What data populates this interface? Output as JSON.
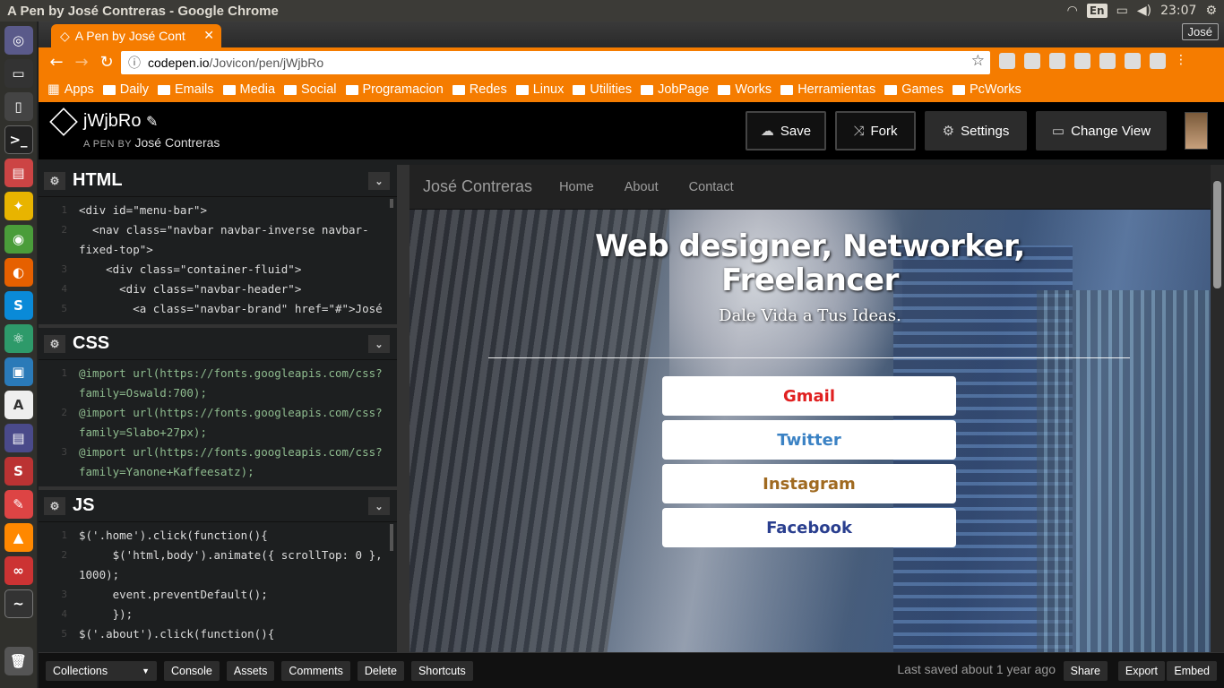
{
  "os": {
    "window_title": "A Pen by José Contreras - Google Chrome",
    "keyboard_layout": "En",
    "clock": "23:07"
  },
  "browser": {
    "tab_title": "A Pen by José Cont",
    "user": "José",
    "url_host": "codepen.io",
    "url_path": "/Jovicon/pen/jWjbRo",
    "bookmarks": [
      "Apps",
      "Daily",
      "Emails",
      "Media",
      "Social",
      "Programacion",
      "Redes",
      "Linux",
      "Utilities",
      "JobPage",
      "Works",
      "Herramientas",
      "Games",
      "PcWorks"
    ]
  },
  "codepen": {
    "pen_title": "jWjbRo",
    "pen_by_label": "A PEN BY",
    "author": "José Contreras",
    "buttons": {
      "save": "Save",
      "fork": "Fork",
      "settings": "Settings",
      "change_view": "Change View"
    },
    "html_editor": {
      "title": "HTML",
      "lines": [
        {
          "n": "1",
          "t": "<div id=\"menu-bar\">"
        },
        {
          "n": "2",
          "t": "  <nav class=\"navbar navbar-inverse navbar-"
        },
        {
          "n": "",
          "t": "fixed-top\">"
        },
        {
          "n": "3",
          "t": "    <div class=\"container-fluid\">"
        },
        {
          "n": "4",
          "t": "      <div class=\"navbar-header\">"
        },
        {
          "n": "5",
          "t": "        <a class=\"navbar-brand\" href=\"#\">José"
        }
      ]
    },
    "css_editor": {
      "title": "CSS",
      "lines": [
        {
          "n": "1",
          "t": "@import url(https://fonts.googleapis.com/css?"
        },
        {
          "n": "",
          "t": "family=Oswald:700);"
        },
        {
          "n": "2",
          "t": "@import url(https://fonts.googleapis.com/css?"
        },
        {
          "n": "",
          "t": "family=Slabo+27px);"
        },
        {
          "n": "3",
          "t": "@import url(https://fonts.googleapis.com/css?"
        },
        {
          "n": "",
          "t": "family=Yanone+Kaffeesatz);"
        }
      ]
    },
    "js_editor": {
      "title": "JS",
      "lines": [
        {
          "n": "1",
          "t": "$('.home').click(function(){"
        },
        {
          "n": "2",
          "t": "     $('html,body').animate({ scrollTop: 0 },"
        },
        {
          "n": "",
          "t": "1000);"
        },
        {
          "n": "3",
          "t": "     event.preventDefault();"
        },
        {
          "n": "4",
          "t": "     });"
        },
        {
          "n": "5",
          "t": "$('.about').click(function(){"
        }
      ]
    },
    "footer": {
      "collections": "Collections",
      "console": "Console",
      "assets": "Assets",
      "comments": "Comments",
      "delete": "Delete",
      "shortcuts": "Shortcuts",
      "last_saved": "Last saved about 1 year ago",
      "share": "Share",
      "export": "Export",
      "embed": "Embed"
    }
  },
  "preview": {
    "brand": "José Contreras",
    "nav": [
      "Home",
      "About",
      "Contact"
    ],
    "headline_line1": "Web designer, Networker,",
    "headline_line2": "Freelancer",
    "tagline": "Dale Vida a Tus Ideas.",
    "social_buttons": [
      {
        "label": "Gmail",
        "color": "#e02020"
      },
      {
        "label": "Twitter",
        "color": "#3b82c4"
      },
      {
        "label": "Instagram",
        "color": "#a06a20"
      },
      {
        "label": "Facebook",
        "color": "#2a3f8f"
      }
    ]
  }
}
